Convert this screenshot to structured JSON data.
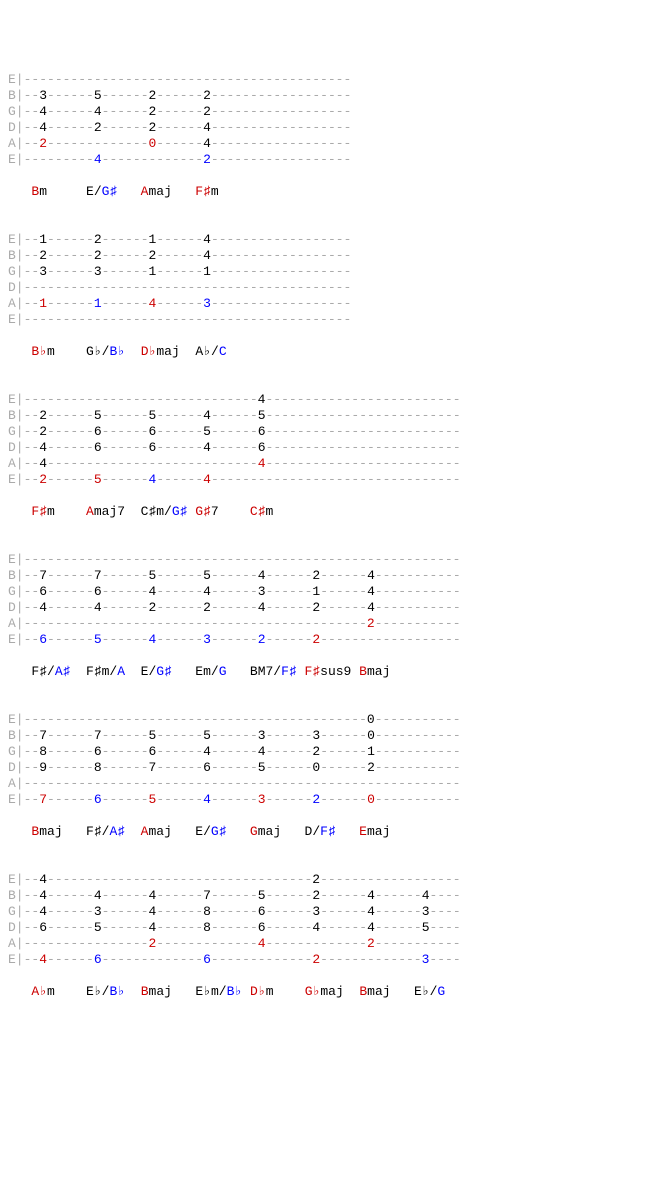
{
  "strings": [
    "E",
    "B",
    "G",
    "D",
    "A",
    "E"
  ],
  "blocks": [
    {
      "tab": [
        [
          "-",
          "-",
          "-",
          "-",
          "-",
          "-"
        ],
        [
          "3",
          "5",
          "2",
          "2",
          "-",
          "-"
        ],
        [
          "4",
          "4",
          "2",
          "2",
          "-",
          "-"
        ],
        [
          "4",
          "2",
          "2",
          "4",
          "-",
          "-"
        ],
        [
          "2",
          "-",
          "0",
          "4",
          "-",
          "-"
        ],
        [
          "-",
          "4",
          "-",
          "2",
          "-",
          "-"
        ]
      ],
      "roots": {
        "A": [
          0,
          2
        ],
        "E": [
          1,
          3
        ]
      },
      "cols": 6,
      "chords": [
        {
          "pre": "",
          "r": "B",
          "suf": "m",
          "b": ""
        },
        {
          "pre": "E/",
          "r": "",
          "suf": "",
          "b": "G♯"
        },
        {
          "pre": "",
          "r": "A",
          "suf": "maj",
          "b": ""
        },
        {
          "pre": "",
          "r": "F♯",
          "suf": "m",
          "b": ""
        }
      ]
    },
    {
      "tab": [
        [
          "1",
          "2",
          "1",
          "4",
          "-",
          "-"
        ],
        [
          "2",
          "2",
          "2",
          "4",
          "-",
          "-"
        ],
        [
          "3",
          "3",
          "1",
          "1",
          "-",
          "-"
        ],
        [
          "-",
          "-",
          "-",
          "-",
          "-",
          "-"
        ],
        [
          "1",
          "1",
          "4",
          "3",
          "-",
          "-"
        ],
        [
          "-",
          "-",
          "-",
          "-",
          "-",
          "-"
        ]
      ],
      "roots": {
        "A": [
          0,
          1,
          2,
          3
        ]
      },
      "rootcolors": {
        "A": [
          "red",
          "blue",
          "red",
          "blue"
        ]
      },
      "cols": 6,
      "chords": [
        {
          "pre": "",
          "r": "B♭",
          "suf": "m",
          "b": ""
        },
        {
          "pre": "G♭/",
          "r": "",
          "suf": "",
          "b": "B♭"
        },
        {
          "pre": "",
          "r": "D♭",
          "suf": "maj",
          "b": ""
        },
        {
          "pre": "A♭/",
          "r": "",
          "suf": "",
          "b": "C"
        }
      ]
    },
    {
      "tab": [
        [
          "-",
          "-",
          "-",
          "-",
          "4",
          "-",
          "-",
          "-"
        ],
        [
          "2",
          "5",
          "5",
          "4",
          "5",
          "-",
          "-",
          "-"
        ],
        [
          "2",
          "6",
          "6",
          "5",
          "6",
          "-",
          "-",
          "-"
        ],
        [
          "4",
          "6",
          "6",
          "4",
          "6",
          "-",
          "-",
          "-"
        ],
        [
          "4",
          "-",
          "-",
          "-",
          "4",
          "-",
          "-",
          "-"
        ],
        [
          "2",
          "5",
          "4",
          "4",
          "-",
          "-",
          "-",
          "-"
        ]
      ],
      "roots": {
        "E": [
          0,
          1,
          2,
          3
        ],
        "A": [
          4
        ]
      },
      "rootcolors": {
        "E": [
          "red",
          "red",
          "blue",
          "red"
        ],
        "A": [
          "red"
        ]
      },
      "cols": 8,
      "chords": [
        {
          "pre": "",
          "r": "F♯",
          "suf": "m",
          "b": ""
        },
        {
          "pre": "",
          "r": "A",
          "suf": "maj7",
          "b": ""
        },
        {
          "pre": "C♯m/",
          "r": "",
          "suf": "",
          "b": "G♯"
        },
        {
          "pre": "",
          "r": "G♯",
          "suf": "7",
          "b": ""
        },
        {
          "pre": "",
          "r": "C♯",
          "suf": "m",
          "b": ""
        }
      ]
    },
    {
      "tab": [
        [
          "-",
          "-",
          "-",
          "-",
          "-",
          "-",
          "-",
          "-"
        ],
        [
          "7",
          "7",
          "5",
          "5",
          "4",
          "2",
          "4",
          "-"
        ],
        [
          "6",
          "6",
          "4",
          "4",
          "3",
          "1",
          "4",
          "-"
        ],
        [
          "4",
          "4",
          "2",
          "2",
          "4",
          "2",
          "4",
          "-"
        ],
        [
          "-",
          "-",
          "-",
          "-",
          "-",
          "-",
          "2",
          "-"
        ],
        [
          "6",
          "5",
          "4",
          "3",
          "2",
          "2",
          "-",
          "-"
        ]
      ],
      "roots": {
        "E": [
          0,
          1,
          2,
          3,
          4,
          5
        ],
        "A": [
          6
        ]
      },
      "rootcolors": {
        "E": [
          "blue",
          "blue",
          "blue",
          "blue",
          "blue",
          "red"
        ],
        "A": [
          "red"
        ]
      },
      "cols": 8,
      "chords": [
        {
          "pre": "F♯/",
          "r": "",
          "suf": "",
          "b": "A♯"
        },
        {
          "pre": "F♯m/",
          "r": "",
          "suf": "",
          "b": "A"
        },
        {
          "pre": "E/",
          "r": "",
          "suf": "",
          "b": "G♯"
        },
        {
          "pre": "Em/",
          "r": "",
          "suf": "",
          "b": "G"
        },
        {
          "pre": "BM7/",
          "r": "",
          "suf": "",
          "b": "F♯"
        },
        {
          "pre": "",
          "r": "F♯",
          "suf": "sus9",
          "b": ""
        },
        {
          "pre": "",
          "r": "B",
          "suf": "maj",
          "b": ""
        }
      ]
    },
    {
      "tab": [
        [
          "-",
          "-",
          "-",
          "-",
          "-",
          "-",
          "0",
          "-"
        ],
        [
          "7",
          "7",
          "5",
          "5",
          "3",
          "3",
          "0",
          "-"
        ],
        [
          "8",
          "6",
          "6",
          "4",
          "4",
          "2",
          "1",
          "-"
        ],
        [
          "9",
          "8",
          "7",
          "6",
          "5",
          "0",
          "2",
          "-"
        ],
        [
          "-",
          "-",
          "-",
          "-",
          "-",
          "-",
          "-",
          "-"
        ],
        [
          "7",
          "6",
          "5",
          "4",
          "3",
          "2",
          "0",
          "-"
        ]
      ],
      "roots": {
        "E": [
          0,
          1,
          2,
          3,
          4,
          5,
          6
        ]
      },
      "rootcolors": {
        "E": [
          "red",
          "blue",
          "red",
          "blue",
          "red",
          "blue",
          "red"
        ]
      },
      "cols": 8,
      "chords": [
        {
          "pre": "",
          "r": "B",
          "suf": "maj",
          "b": ""
        },
        {
          "pre": "F♯/",
          "r": "",
          "suf": "",
          "b": "A♯"
        },
        {
          "pre": "",
          "r": "A",
          "suf": "maj",
          "b": ""
        },
        {
          "pre": "E/",
          "r": "",
          "suf": "",
          "b": "G♯"
        },
        {
          "pre": "",
          "r": "G",
          "suf": "maj",
          "b": ""
        },
        {
          "pre": "D/",
          "r": "",
          "suf": "",
          "b": "F♯"
        },
        {
          "pre": "",
          "r": "E",
          "suf": "maj",
          "b": ""
        }
      ]
    },
    {
      "tab": [
        [
          "4",
          "-",
          "-",
          "-",
          "-",
          "2",
          "-",
          "-"
        ],
        [
          "4",
          "4",
          "4",
          "7",
          "5",
          "2",
          "4",
          "4"
        ],
        [
          "4",
          "3",
          "4",
          "8",
          "6",
          "3",
          "4",
          "3"
        ],
        [
          "6",
          "5",
          "4",
          "8",
          "6",
          "4",
          "4",
          "5"
        ],
        [
          "-",
          "-",
          "2",
          "-",
          "4",
          "-",
          "2",
          "-"
        ],
        [
          "4",
          "6",
          "-",
          "6",
          "-",
          "2",
          "-",
          "3"
        ]
      ],
      "roots": {
        "E": [
          0,
          1,
          3,
          5,
          7
        ],
        "A": [
          2,
          4,
          6
        ]
      },
      "rootcolors": {
        "E": [
          "red",
          "blue",
          "blue",
          "red",
          "blue"
        ],
        "A": [
          "red",
          "red",
          "red"
        ]
      },
      "cols": 8,
      "chords": [
        {
          "pre": "",
          "r": "A♭",
          "suf": "m",
          "b": ""
        },
        {
          "pre": "E♭/",
          "r": "",
          "suf": "",
          "b": "B♭"
        },
        {
          "pre": "",
          "r": "B",
          "suf": "maj",
          "b": ""
        },
        {
          "pre": "E♭m/",
          "r": "",
          "suf": "",
          "b": "B♭"
        },
        {
          "pre": "",
          "r": "D♭",
          "suf": "m",
          "b": ""
        },
        {
          "pre": "",
          "r": "G♭",
          "suf": "maj",
          "b": ""
        },
        {
          "pre": "",
          "r": "B",
          "suf": "maj",
          "b": ""
        },
        {
          "pre": "E♭/",
          "r": "",
          "suf": "",
          "b": "G"
        }
      ]
    }
  ]
}
